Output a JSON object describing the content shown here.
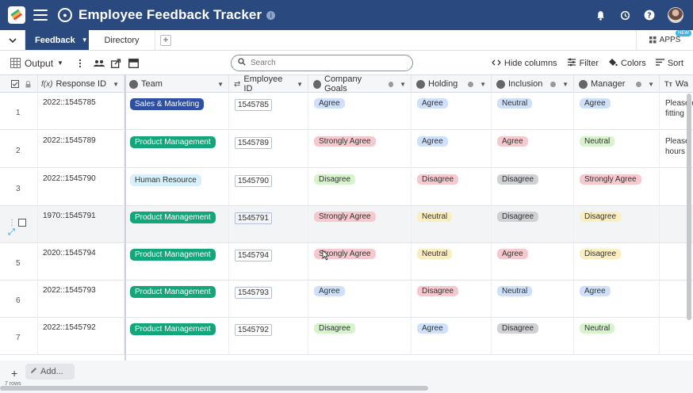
{
  "app": {
    "title": "Employee Feedback Tracker"
  },
  "tabs": {
    "active": "Feedback",
    "other": "Directory",
    "apps_label": "APPS",
    "apps_badge": "NEW"
  },
  "toolbar": {
    "view_name": "Output",
    "search_placeholder": "Search",
    "hide_columns": "Hide columns",
    "filter": "Filter",
    "colors": "Colors",
    "sort": "Sort"
  },
  "columns": [
    {
      "key": "response_id",
      "label": "Response ID"
    },
    {
      "key": "team",
      "label": "Team"
    },
    {
      "key": "employee_id",
      "label": "Employee ID"
    },
    {
      "key": "company_goals",
      "label": "Company Goals"
    },
    {
      "key": "holding",
      "label": "Holding"
    },
    {
      "key": "inclusion",
      "label": "Inclusion"
    },
    {
      "key": "manager",
      "label": "Manager"
    },
    {
      "key": "wa",
      "label": "Wa"
    }
  ],
  "rows": [
    {
      "num": "1",
      "response_id": "2022::1545785",
      "team": "Sales & Marketing",
      "employee_id": "1545785",
      "company_goals": "Agree",
      "holding": "Agree",
      "inclusion": "Neutral",
      "manager": "Agree",
      "wa": [
        "Please d",
        "fitting"
      ]
    },
    {
      "num": "2",
      "response_id": "2022::1545789",
      "team": "Product Management",
      "employee_id": "1545789",
      "company_goals": "Strongly Agree",
      "holding": "Agree",
      "inclusion": "Agree",
      "manager": "Neutral",
      "wa": [
        "Please",
        "hours"
      ]
    },
    {
      "num": "3",
      "response_id": "2022::1545790",
      "team": "Human Resource",
      "employee_id": "1545790",
      "company_goals": "Disagree",
      "holding": "Disagree",
      "inclusion": "Disagree",
      "manager": "Strongly Agree",
      "wa": [
        "",
        ""
      ]
    },
    {
      "num": "",
      "response_id": "1970::1545791",
      "team": "Product Management",
      "employee_id": "1545791",
      "company_goals": "Strongly Agree",
      "holding": "Neutral",
      "inclusion": "Disagree",
      "manager": "Disagree",
      "wa": [
        "",
        ""
      ]
    },
    {
      "num": "5",
      "response_id": "2020::1545794",
      "team": "Product Management",
      "employee_id": "1545794",
      "company_goals": "Strongly Agree",
      "holding": "Neutral",
      "inclusion": "Agree",
      "manager": "Disagree",
      "wa": [
        "",
        ""
      ]
    },
    {
      "num": "6",
      "response_id": "2022::1545793",
      "team": "Product Management",
      "employee_id": "1545793",
      "company_goals": "Agree",
      "holding": "Disagree",
      "inclusion": "Neutral",
      "manager": "Agree",
      "wa": [
        "",
        ""
      ]
    },
    {
      "num": "7",
      "response_id": "2022::1545792",
      "team": "Product Management",
      "employee_id": "1545792",
      "company_goals": "Disagree",
      "holding": "Agree",
      "inclusion": "Disagree",
      "manager": "Neutral",
      "wa": [
        "",
        ""
      ]
    }
  ],
  "footer": {
    "add_label": "Add...",
    "row_count": "7 rows"
  },
  "colors": {
    "header_bg": "#2a4a7f",
    "team": {
      "Sales & Marketing": "#2f4fa3",
      "Product Management": "#12a67a",
      "Human Resource": "#d7f0fb"
    },
    "rating": {
      "Agree": "#cfe0fb",
      "Strongly Agree": "#f6c9cf",
      "Neutral": "#fbeec0",
      "Disagree": "#d6f3cc"
    },
    "holding": {
      "Agree": "#cfe0fb",
      "Neutral": "#fbeec0",
      "Disagree": "#f6c9cf"
    },
    "inclusion": {
      "Neutral": "#cfe0fb",
      "Agree": "#f6c9cf",
      "Disagree": "#cfd1d4"
    },
    "manager": {
      "Agree": "#cfe0fb",
      "Neutral": "#d6f3cc",
      "Strongly Agree": "#f6c9cf",
      "Disagree": "#fbeec0"
    }
  }
}
